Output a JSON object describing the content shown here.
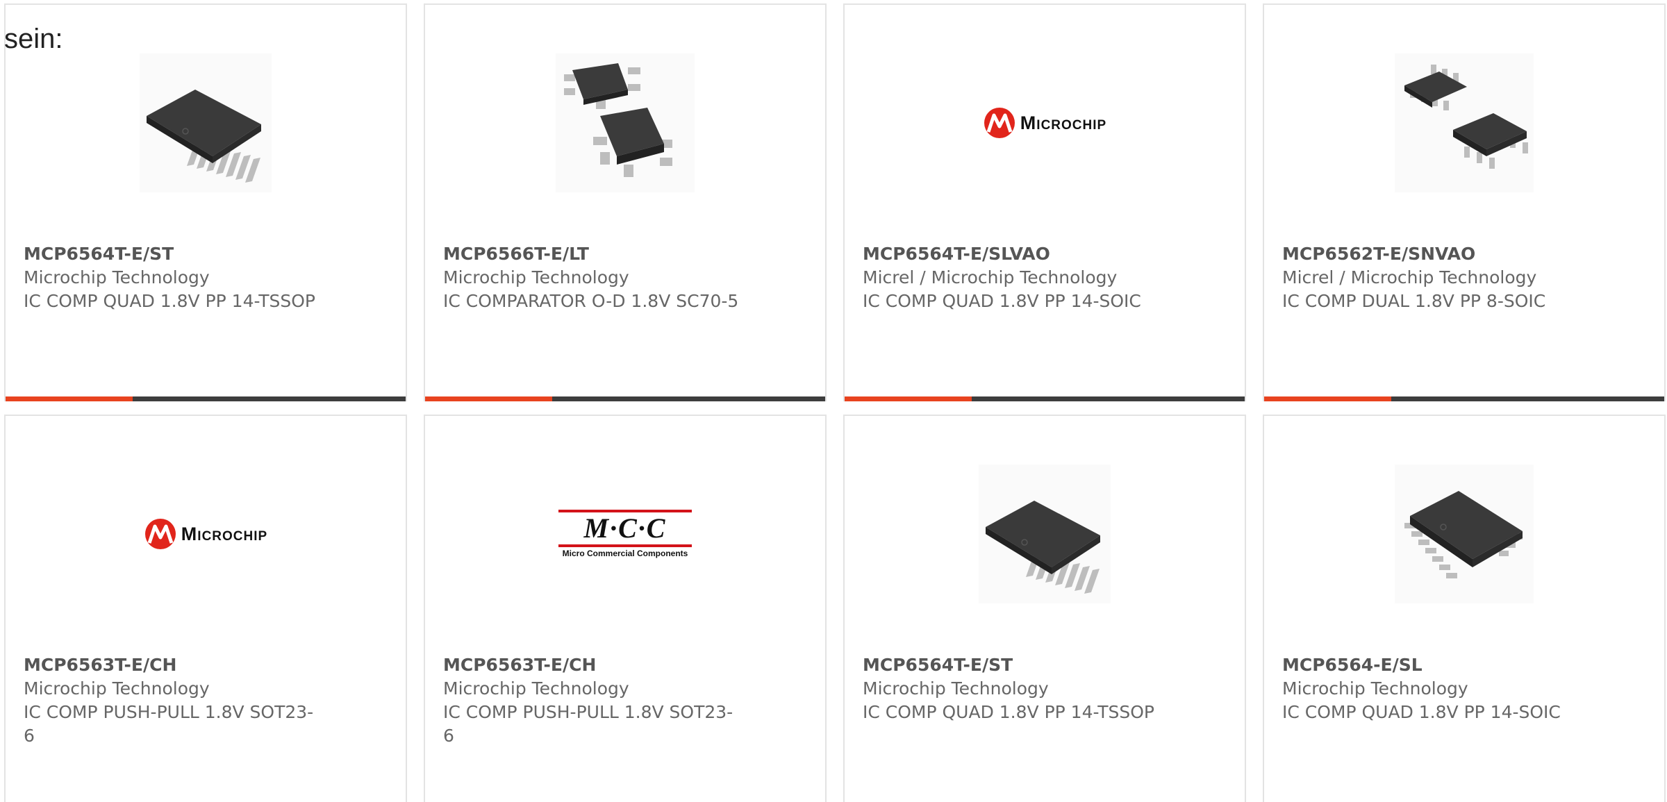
{
  "heading": "sein:",
  "accent_color": "#e8431f",
  "bar_color": "#3d3d3d",
  "products": [
    {
      "part": "MCP6564T-E/ST",
      "maker": "Microchip Technology",
      "desc": "IC COMP QUAD 1.8V PP 14-TSSOP",
      "image": "tssop-14-chip-image"
    },
    {
      "part": "MCP6566T-E/LT",
      "maker": "Microchip Technology",
      "desc": "IC COMPARATOR O-D 1.8V SC70-5",
      "image": "sc70-5-chip-image"
    },
    {
      "part": "MCP6564T-E/SLVAO",
      "maker": "Micrel / Microchip Technology",
      "desc": "IC COMP QUAD 1.8V PP 14-SOIC",
      "image": "microchip-logo",
      "logo_text": "Microchip"
    },
    {
      "part": "MCP6562T-E/SNVAO",
      "maker": "Micrel / Microchip Technology",
      "desc": "IC COMP DUAL 1.8V PP 8-SOIC",
      "image": "soic-8-chip-image"
    },
    {
      "part": "MCP6563T-E/CH",
      "maker": "Microchip Technology",
      "desc": "IC COMP PUSH-PULL 1.8V SOT23-6",
      "image": "microchip-logo",
      "logo_text": "Microchip"
    },
    {
      "part": "MCP6563T-E/CH",
      "maker": "Microchip Technology",
      "desc": "IC COMP PUSH-PULL 1.8V SOT23-6",
      "image": "mcc-logo",
      "logo_text": "M·C·C",
      "logo_sub": "Micro Commercial Components"
    },
    {
      "part": "MCP6564T-E/ST",
      "maker": "Microchip Technology",
      "desc": "IC COMP QUAD 1.8V PP 14-TSSOP",
      "image": "tssop-14-chip-image"
    },
    {
      "part": "MCP6564-E/SL",
      "maker": "Microchip Technology",
      "desc": "IC COMP QUAD 1.8V PP 14-SOIC",
      "image": "soic-14-chip-image"
    }
  ]
}
